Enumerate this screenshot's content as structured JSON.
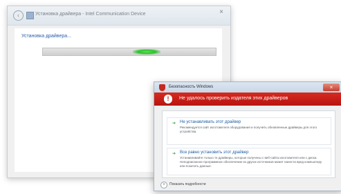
{
  "wizard": {
    "title": "Установка драйвера - Intel Communication Device",
    "status_text": "Установка драйвера...",
    "close_glyph": "×",
    "back_glyph": "‹"
  },
  "security_dialog": {
    "title": "Безопасность Windows",
    "close_glyph": "×",
    "banner_icon_glyph": "!",
    "banner_text": "Не удалось проверить издателя этих драйверов",
    "colors": {
      "banner": "#c71b15",
      "link": "#1d5ca6",
      "arrow": "#2d9b2d"
    },
    "options": [
      {
        "arrow": "➔",
        "title": "Не устанавливать этот драйвер",
        "description": "Рекомендуется сайт изготовителя оборудования и получить обновленные драйверы для этого устройства."
      },
      {
        "arrow": "➔",
        "title": "Все равно установить этот драйвер",
        "description": "Устанавливайте только те драйверы, которые получены с веб-сайта изготовителя или с диска. Неподписанное программное обеспечение из других источников может нанести вред компьютеру или похитить данные."
      }
    ],
    "footer_toggle_glyph": "˅",
    "footer_text": "Показать подробности"
  },
  "progress": {
    "value_fraction": 0.62
  }
}
